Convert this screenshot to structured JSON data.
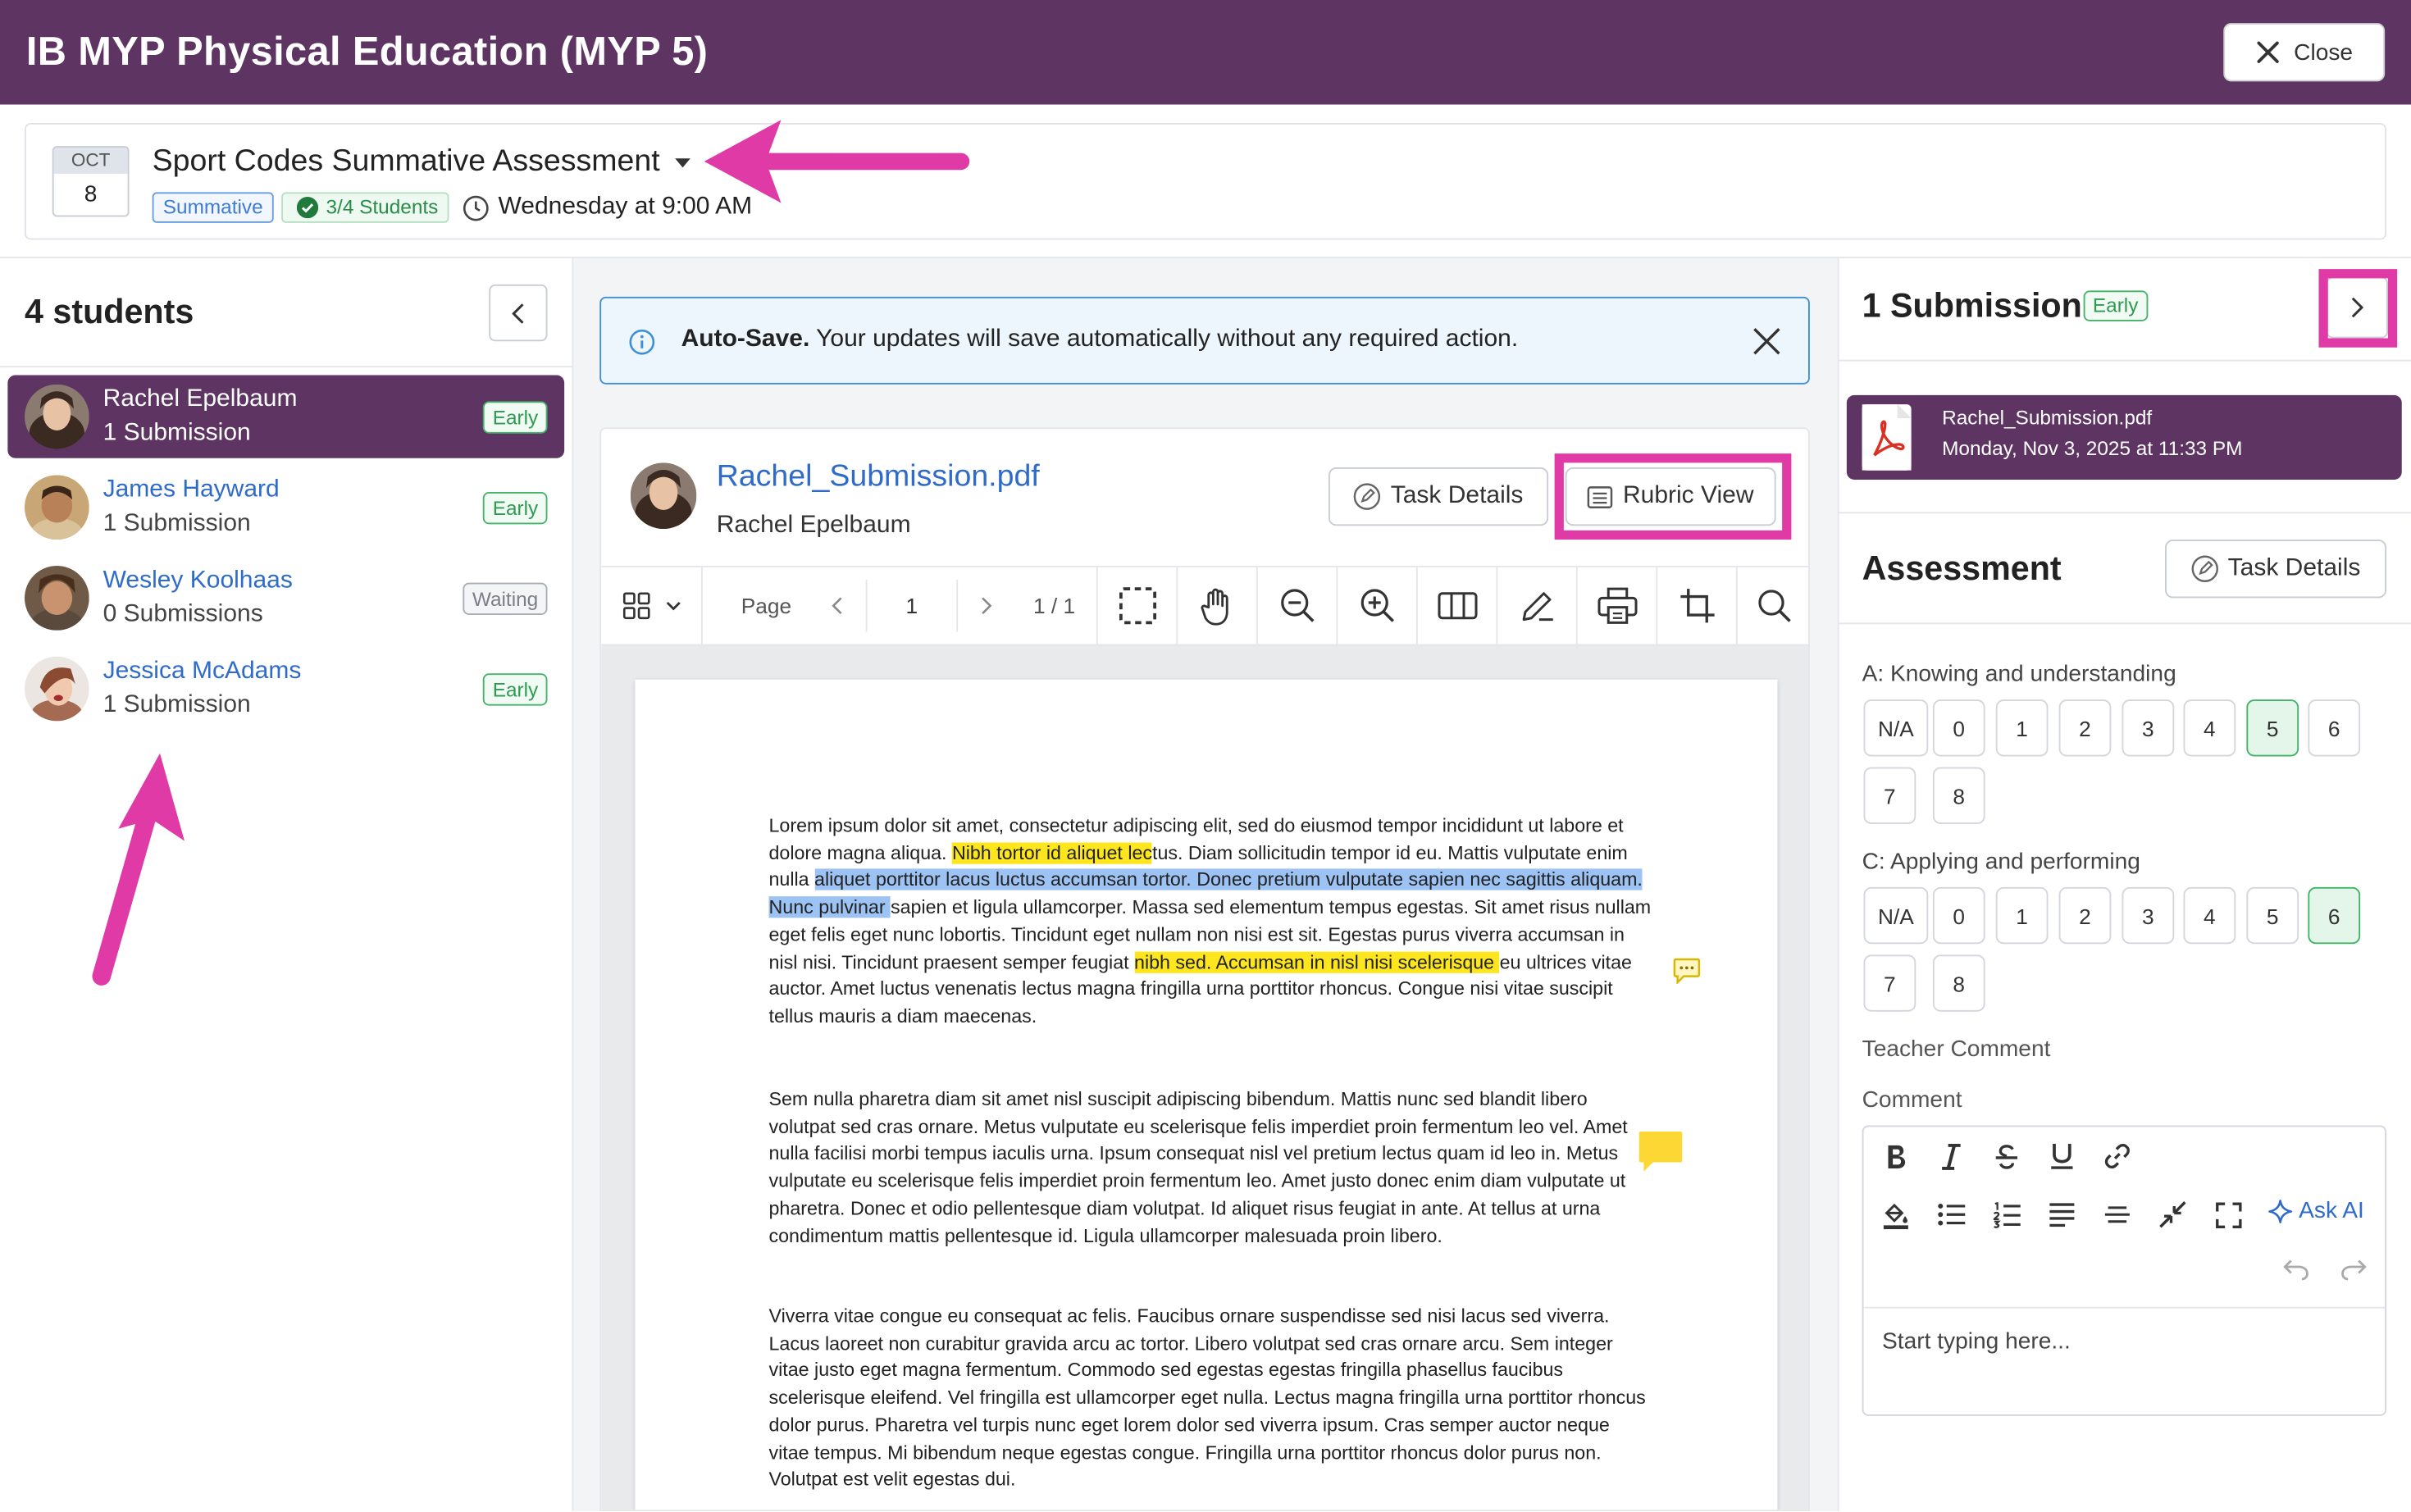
{
  "header": {
    "title": "IB MYP Physical Education (MYP 5)",
    "close_label": "Close"
  },
  "assignment": {
    "cal_month": "OCT",
    "cal_day": "8",
    "title": "Sport Codes Summative Assessment",
    "type_tag": "Summative",
    "students_tag": "3/4 Students",
    "due": "Wednesday at 9:00 AM"
  },
  "students_panel": {
    "title": "4 students",
    "students": [
      {
        "name": "Rachel Epelbaum",
        "submissions": "1 Submission",
        "status": "Early"
      },
      {
        "name": "James Hayward",
        "submissions": "1 Submission",
        "status": "Early"
      },
      {
        "name": "Wesley Koolhaas",
        "submissions": "0 Submissions",
        "status": "Waiting"
      },
      {
        "name": "Jessica McAdams",
        "submissions": "1 Submission",
        "status": "Early"
      }
    ]
  },
  "autosave": {
    "bold": "Auto-Save.",
    "text": " Your updates will save automatically without any required action."
  },
  "viewer": {
    "file_name": "Rachel_Submission.pdf",
    "owner": "Rachel Epelbaum",
    "task_details_label": "Task Details",
    "rubric_view_label": "Rubric View",
    "page_label": "Page",
    "page_value": "1",
    "page_count": "1 / 1"
  },
  "document": {
    "p1": {
      "s1": "Lorem ipsum dolor sit amet, consectetur adipiscing elit, sed do eiusmod tempor incididunt ut labore et dolore magna aliqua. ",
      "h1": "Nibh tortor id aliquet lec",
      "s2": "tus. Diam sollicitudin tempor id eu. Mattis vulputate enim nulla ",
      "h2": "aliquet porttitor lacus luctus accumsan tortor. Donec pretium vulputate sapien nec sagittis aliquam. Nunc pulvinar ",
      "s3": "sapien et ligula ullamcorper. Massa sed elementum tempus egestas. Sit amet risus nullam eget felis eget nunc lobortis. Tincidunt eget nullam non nisi est sit. Egestas purus viverra accumsan in nisl nisi. Tincidunt praesent semper feugiat ",
      "h3": "nibh sed. Accumsan in nisl nisi scelerisque ",
      "s4": "eu ultrices vitae auctor. Amet luctus venenatis lectus magna fringilla urna porttitor rhoncus. Congue nisi vitae suscipit tellus mauris a diam maecenas."
    },
    "p2": "Sem nulla pharetra diam sit amet nisl suscipit adipiscing bibendum. Mattis nunc sed blandit libero volutpat sed cras ornare. Metus vulputate eu scelerisque felis imperdiet proin fermentum leo vel. Amet nulla facilisi morbi tempus iaculis urna. Ipsum consequat nisl vel pretium lectus quam id leo in. Metus vulputate eu scelerisque felis imperdiet proin fermentum leo. Amet justo donec enim diam vulputate ut pharetra. Donec et odio pellentesque diam volutpat. Id aliquet risus feugiat in ante. At tellus at urna condimentum mattis pellentesque id. Ligula ullamcorper malesuada proin libero.",
    "p3": "Viverra vitae congue eu consequat ac felis. Faucibus ornare suspendisse sed nisi lacus sed viverra. Lacus laoreet non curabitur gravida arcu ac tortor. Libero volutpat sed cras ornare arcu. Sem integer vitae justo eget magna fermentum. Commodo sed egestas egestas fringilla phasellus faucibus scelerisque eleifend. Vel fringilla est ullamcorper eget nulla. Lectus magna fringilla urna porttitor rhoncus dolor purus. Pharetra vel turpis nunc eget lorem dolor sed viverra ipsum. Cras semper auctor neque vitae tempus. Mi bibendum neque egestas congue. Fringilla urna porttitor rhoncus dolor purus non. Volutpat est velit egestas dui."
  },
  "submission_panel": {
    "title": "1 Submission",
    "status": "Early",
    "file_name": "Rachel_Submission.pdf",
    "file_date": "Monday, Nov 3, 2025 at 11:33 PM"
  },
  "assessment": {
    "title": "Assessment",
    "task_details_label": "Task Details",
    "criteria": [
      {
        "label": "A: Knowing and understanding",
        "options": [
          "N/A",
          "0",
          "1",
          "2",
          "3",
          "4",
          "5",
          "6",
          "7",
          "8"
        ],
        "selected": "5"
      },
      {
        "label": "C: Applying and performing",
        "options": [
          "N/A",
          "0",
          "1",
          "2",
          "3",
          "4",
          "5",
          "6",
          "7",
          "8"
        ],
        "selected": "6"
      }
    ],
    "teacher_comment_label": "Teacher Comment",
    "comment_label": "Comment",
    "ask_ai_label": "Ask AI",
    "comment_placeholder": "Start typing here..."
  },
  "colors": {
    "brand": "#5e3462",
    "link": "#2f6bc9",
    "annotation_highlight": "#e03aa7",
    "early": "#2e9a52",
    "highlight_yellow": "#fde61e",
    "highlight_blue": "#9cc3f3"
  },
  "icons": [
    "close-icon",
    "caret-down-icon",
    "check-circle-icon",
    "clock-icon",
    "chevron-left-icon",
    "chevron-right-icon",
    "info-icon",
    "pdf-icon",
    "edit-icon",
    "list-icon",
    "grid-icon",
    "marquee-select-icon",
    "hand-icon",
    "zoom-out-icon",
    "zoom-in-icon",
    "columns-icon",
    "pen-icon",
    "print-icon",
    "crop-icon",
    "search-icon",
    "comment-icon",
    "note-icon",
    "bold-icon",
    "italic-icon",
    "strikethrough-icon",
    "underline-icon",
    "link-icon",
    "fill-color-icon",
    "bullet-list-icon",
    "numbered-list-icon",
    "align-icon",
    "horizontal-rule-icon",
    "compress-icon",
    "fullscreen-icon",
    "sparkle-icon",
    "undo-icon",
    "redo-icon"
  ]
}
